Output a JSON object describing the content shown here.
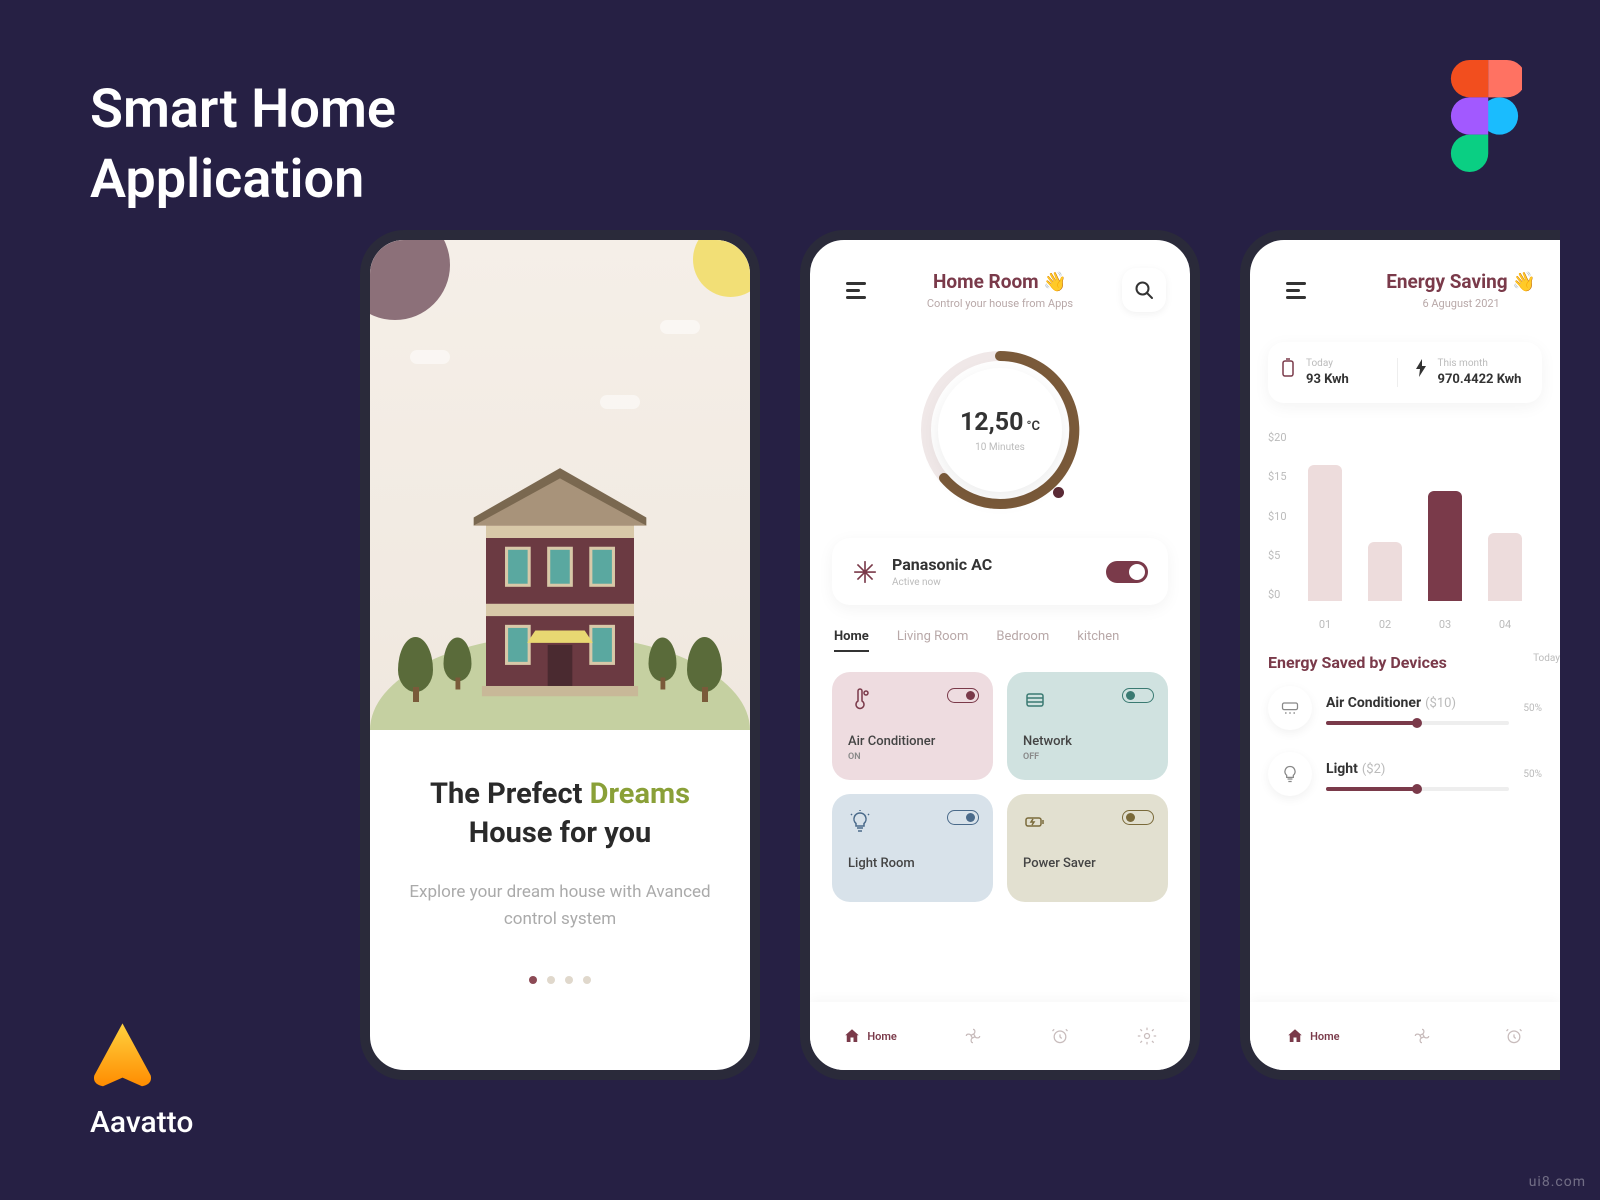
{
  "page": {
    "title_line1": "Smart Home",
    "title_line2": "Application",
    "brand": "Aavatto",
    "watermark": "ui8.com"
  },
  "onboarding": {
    "heading_pre": "The Prefect ",
    "heading_accent": "Dreams",
    "heading_post": "House for you",
    "sub": "Explore your dream house with Avanced control system",
    "dots": 4,
    "active_dot": 0
  },
  "home": {
    "title": "Home Room 👋",
    "subtitle": "Control your house from Apps",
    "gauge": {
      "value": "12,50",
      "unit": "°C",
      "sub": "10 Minutes"
    },
    "device": {
      "name": "Panasonic AC",
      "status": "Active now",
      "on": true
    },
    "tabs": [
      "Home",
      "Living Room",
      "Bedroom",
      "kitchen"
    ],
    "active_tab": 0,
    "cards": [
      {
        "name": "Air Conditioner",
        "state": "ON",
        "icon": "thermometer",
        "color": "pink",
        "on": true
      },
      {
        "name": "Network",
        "state": "OFF",
        "icon": "router",
        "color": "teal",
        "on": false
      },
      {
        "name": "Light Room",
        "state": "",
        "icon": "bulb",
        "color": "blue",
        "on": true
      },
      {
        "name": "Power Saver",
        "state": "",
        "icon": "battery",
        "color": "olive",
        "on": false
      }
    ],
    "nav": [
      {
        "label": "Home",
        "icon": "home",
        "active": true
      },
      {
        "label": "",
        "icon": "fan"
      },
      {
        "label": "",
        "icon": "alarm"
      },
      {
        "label": "",
        "icon": "settings"
      }
    ]
  },
  "energy": {
    "title": "Energy Saving 👋",
    "subtitle": "6 Agugust 2021",
    "stats": [
      {
        "label": "Today",
        "value": "93 Kwh",
        "icon": "battery"
      },
      {
        "label": "This month",
        "value": "970.4422 Kwh",
        "icon": "bolt"
      }
    ],
    "section": "Energy Saved by Devices",
    "filter": "Today",
    "devices": [
      {
        "name": "Air Conditioner",
        "price": "($10)",
        "pct": "50%",
        "fill": 50,
        "icon": "ac"
      },
      {
        "name": "Light",
        "price": "($2)",
        "pct": "50%",
        "fill": 50,
        "icon": "bulb"
      }
    ],
    "nav": [
      {
        "label": "Home",
        "icon": "home",
        "active": true
      },
      {
        "label": "",
        "icon": "fan"
      },
      {
        "label": "",
        "icon": "alarm"
      }
    ]
  },
  "chart_data": {
    "type": "bar",
    "title": "",
    "xlabel": "",
    "ylabel": "",
    "categories": [
      "01",
      "02",
      "03",
      "04"
    ],
    "values": [
      16,
      7,
      13,
      8
    ],
    "highlight_index": 2,
    "ylim": [
      0,
      20
    ],
    "yticks": [
      "$20",
      "$15",
      "$10",
      "$5",
      "$0"
    ]
  }
}
